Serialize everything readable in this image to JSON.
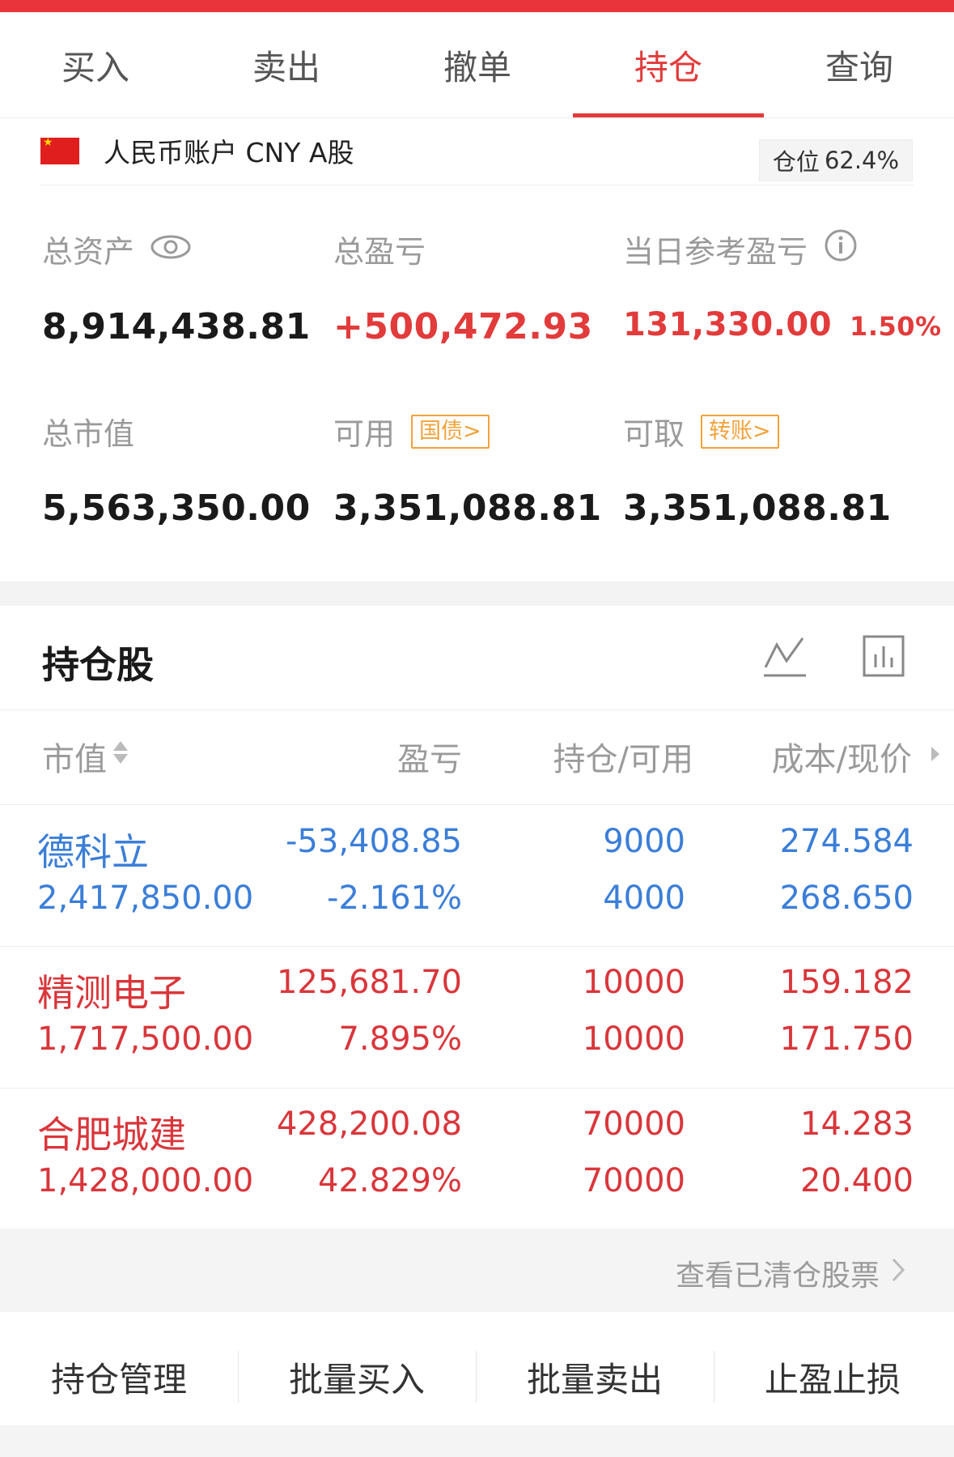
{
  "tabs": [
    "买入",
    "卖出",
    "撤单",
    "持仓",
    "查询"
  ],
  "active_tab": "持仓",
  "account": {
    "name": "人民币账户 CNY A股",
    "position_label": "仓位",
    "position_value": "62.4%"
  },
  "summary": {
    "total_assets_label": "总资产",
    "total_assets": "8,914,438.81",
    "total_pl_label": "总盈亏",
    "total_pl": "+500,472.93",
    "daily_pl_label": "当日参考盈亏",
    "daily_pl": "131,330.00",
    "daily_pl_pct": "1.50%",
    "market_value_label": "总市值",
    "market_value": "5,563,350.00",
    "available_label": "可用",
    "available_tag": "国债>",
    "available": "3,351,088.81",
    "withdrawable_label": "可取",
    "withdrawable_tag": "转账>",
    "withdrawable": "3,351,088.81"
  },
  "holdings_title": "持仓股",
  "columns": {
    "market_value": "市值",
    "pl": "盈亏",
    "position_available": "持仓/可用",
    "cost_price": "成本/现价"
  },
  "holdings": [
    {
      "name": "德科立",
      "market_value": "2,417,850.00",
      "pl": "-53,408.85",
      "pl_pct": "-2.161%",
      "position": "9000",
      "available": "4000",
      "cost": "274.584",
      "price": "268.650",
      "color": "#3b7ed8"
    },
    {
      "name": "精测电子",
      "market_value": "1,717,500.00",
      "pl": "125,681.70",
      "pl_pct": "7.895%",
      "position": "10000",
      "available": "10000",
      "cost": "159.182",
      "price": "171.750",
      "color": "#d9363b"
    },
    {
      "name": "合肥城建",
      "market_value": "1,428,000.00",
      "pl": "428,200.08",
      "pl_pct": "42.829%",
      "position": "70000",
      "available": "70000",
      "cost": "14.283",
      "price": "20.400",
      "color": "#d9363b"
    }
  ],
  "cleared_link": "查看已清仓股票",
  "actions": [
    "持仓管理",
    "批量买入",
    "批量卖出",
    "止盈止损"
  ],
  "colors": {
    "accent": "#e23b3b",
    "loss": "#3b7ed8",
    "tag": "#f2a23a"
  }
}
